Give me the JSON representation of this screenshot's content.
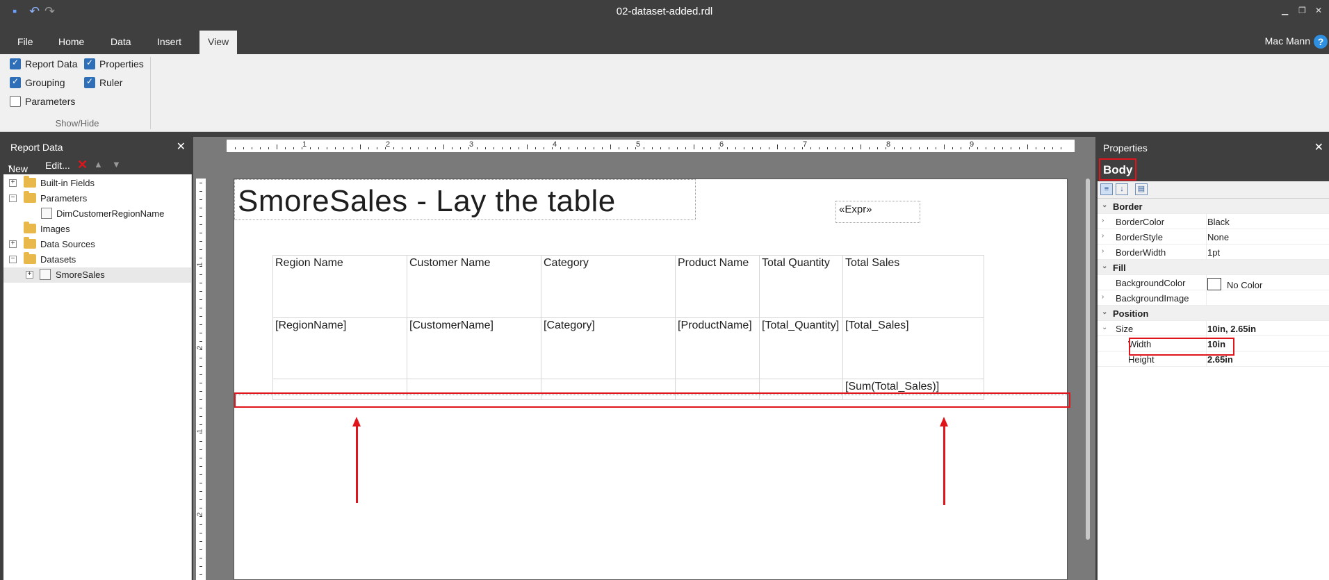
{
  "window": {
    "title": "02-dataset-added.rdl"
  },
  "menu": {
    "items": [
      "File",
      "Home",
      "Data",
      "Insert",
      "View"
    ],
    "active": "View",
    "user": "Mac Mann",
    "help": "?"
  },
  "ribbon": {
    "checkboxes": [
      {
        "label": "Report Data",
        "checked": true
      },
      {
        "label": "Properties",
        "checked": true
      },
      {
        "label": "Grouping",
        "checked": true
      },
      {
        "label": "Ruler",
        "checked": true
      },
      {
        "label": "Parameters",
        "checked": false
      }
    ],
    "group_label": "Show/Hide"
  },
  "report_data": {
    "title": "Report Data",
    "toolbar": {
      "new": "New",
      "edit": "Edit..."
    },
    "tree": [
      {
        "label": "Built-in Fields",
        "type": "folder",
        "expander": "+"
      },
      {
        "label": "Parameters",
        "type": "folder",
        "expander": "−"
      },
      {
        "label": "DimCustomerRegionName",
        "type": "parameter",
        "expander": ""
      },
      {
        "label": "Images",
        "type": "folder",
        "expander": ""
      },
      {
        "label": "Data Sources",
        "type": "folder",
        "expander": "+"
      },
      {
        "label": "Datasets",
        "type": "folder",
        "expander": "−"
      },
      {
        "label": "SmoreSales",
        "type": "dataset",
        "expander": "+"
      }
    ]
  },
  "design": {
    "ruler_numbers": [
      "1",
      "2",
      "3",
      "4",
      "5",
      "6",
      "7",
      "8",
      "9"
    ],
    "vruler_numbers": [
      "1",
      "2",
      "1",
      "2"
    ],
    "report_title": "SmoreSales - Lay the table",
    "expr": "«Expr»",
    "table": {
      "headers": [
        "Region Name",
        "Customer Name",
        "Category",
        "Product Name",
        "Total Quantity",
        "Total Sales"
      ],
      "details": [
        "[RegionName]",
        "[CustomerName]",
        "[Category]",
        "[ProductName]",
        "[Total_Quantity]",
        "[Total_Sales]"
      ],
      "totals": [
        "",
        "",
        "",
        "",
        "",
        "[Sum(Total_Sales)]"
      ]
    }
  },
  "properties": {
    "title": "Properties",
    "object": "Body",
    "rows": [
      {
        "kind": "cat",
        "name": "Border",
        "caret": "⌄"
      },
      {
        "kind": "prop",
        "name": "BorderColor",
        "value": "Black",
        "caret": "›"
      },
      {
        "kind": "prop",
        "name": "BorderStyle",
        "value": "None",
        "caret": "›"
      },
      {
        "kind": "prop",
        "name": "BorderWidth",
        "value": "1pt",
        "caret": "›"
      },
      {
        "kind": "cat",
        "name": "Fill",
        "caret": "⌄"
      },
      {
        "kind": "prop",
        "name": "BackgroundColor",
        "value": "No Color",
        "swatch": true
      },
      {
        "kind": "prop",
        "name": "BackgroundImage",
        "value": "",
        "caret": "›"
      },
      {
        "kind": "cat",
        "name": "Position",
        "caret": "⌄"
      },
      {
        "kind": "prop",
        "name": "Size",
        "value": "10in, 2.65in",
        "caret": "⌄",
        "bold": true
      },
      {
        "kind": "sub",
        "name": "Width",
        "value": "10in",
        "bold": true
      },
      {
        "kind": "sub",
        "name": "Height",
        "value": "2.65in",
        "bold": true
      }
    ]
  },
  "colors": {
    "chrome": "#3f3f3f",
    "ribbon": "#f0f0f0",
    "accent": "#2f6fb8",
    "highlight": "#e0141b"
  }
}
